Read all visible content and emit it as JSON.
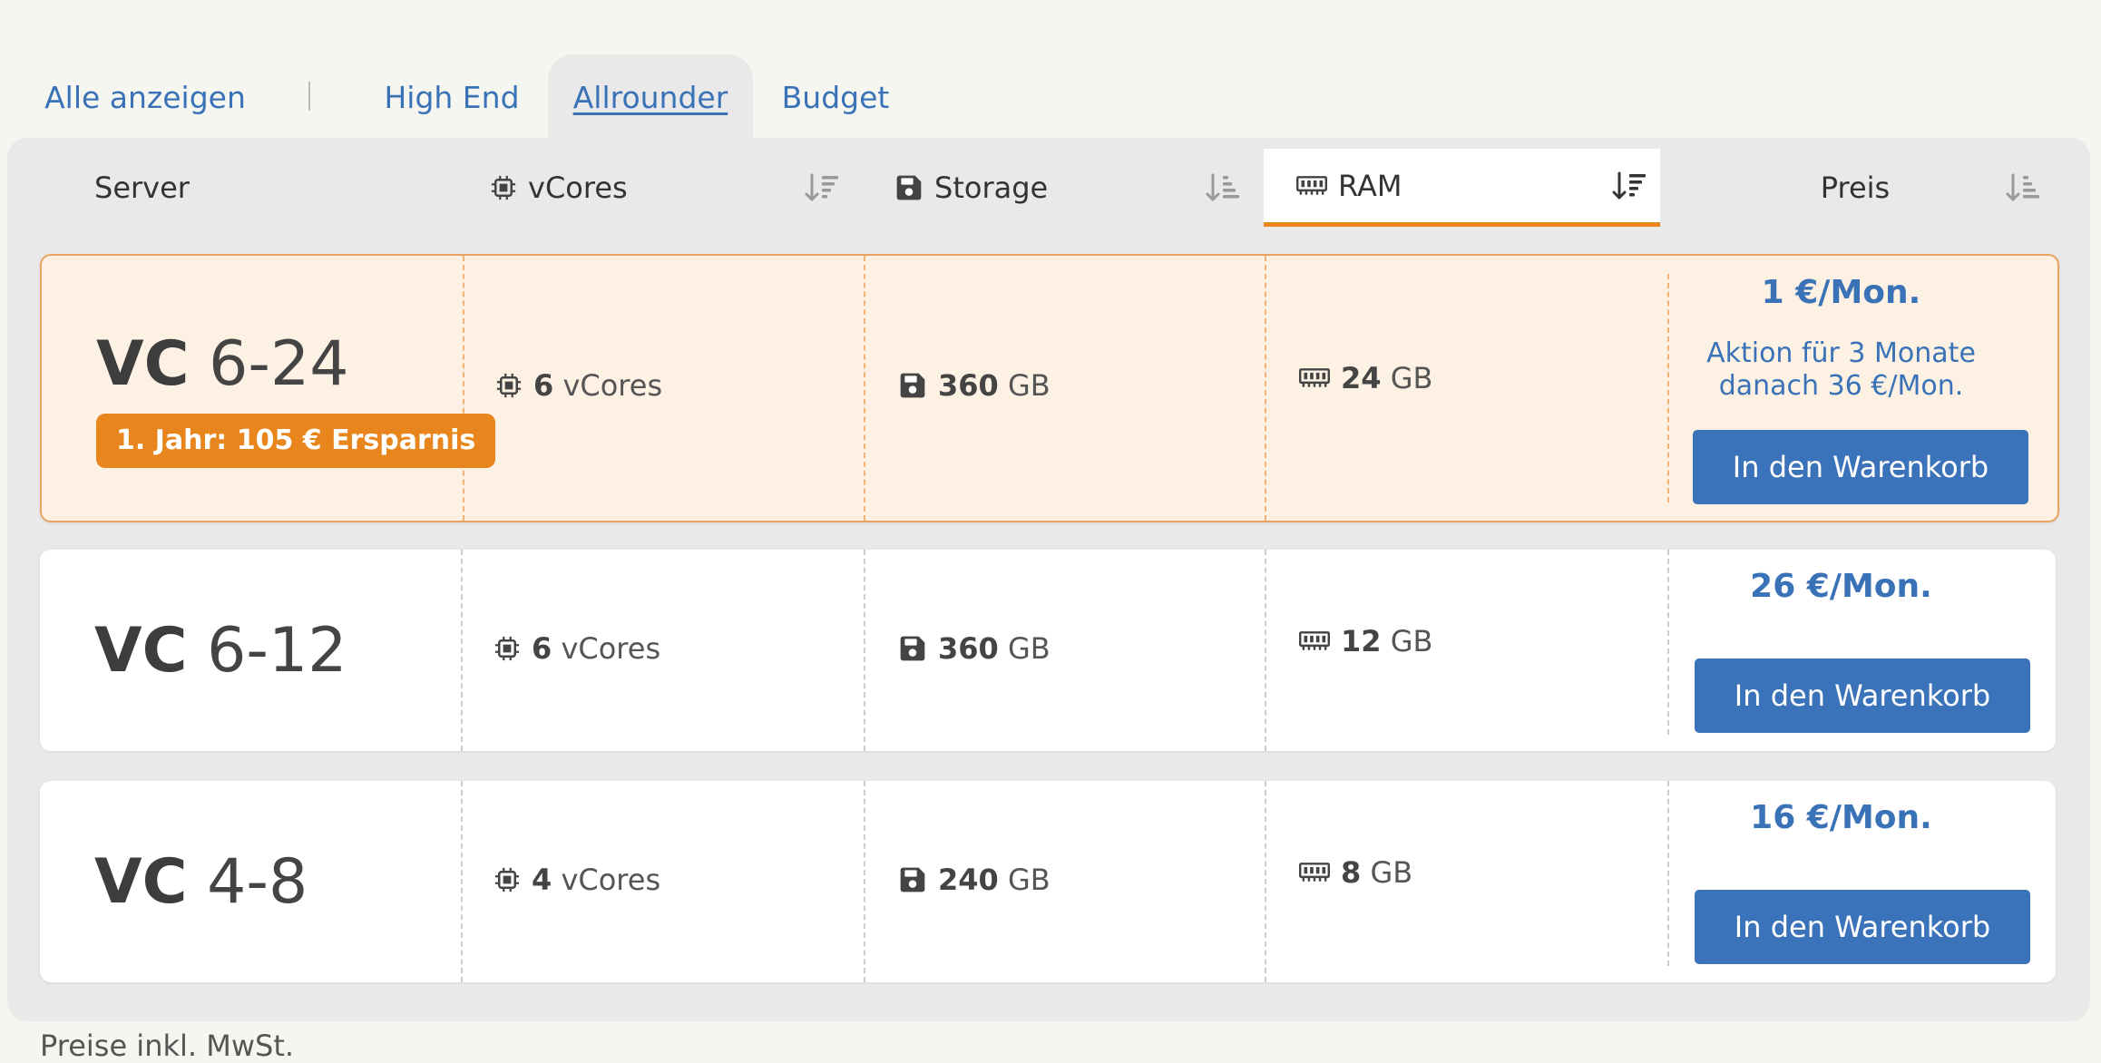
{
  "tabs": [
    {
      "label": "Alle anzeigen"
    },
    {
      "label": "High End"
    },
    {
      "label": "Allrounder",
      "active": true
    },
    {
      "label": "Budget"
    }
  ],
  "table": {
    "headers": {
      "server": "Server",
      "vcores": "vCores",
      "storage": "Storage",
      "ram": "RAM",
      "price": "Preis"
    },
    "sorted_column": "RAM"
  },
  "rows": [
    {
      "name_prefix": "VC",
      "name_suffix": "6-24",
      "badge": "1. Jahr: 105 € Ersparnis",
      "vcores_value": "6",
      "vcores_unit": "vCores",
      "storage_value": "360",
      "storage_unit": "GB",
      "ram_value": "24",
      "ram_unit": "GB",
      "price": "1 €/Mon.",
      "promo_line1": "Aktion für 3 Monate",
      "promo_line2": "danach 36 €/Mon.",
      "button": "In den Warenkorb"
    },
    {
      "name_prefix": "VC",
      "name_suffix": "6-12",
      "vcores_value": "6",
      "vcores_unit": "vCores",
      "storage_value": "360",
      "storage_unit": "GB",
      "ram_value": "12",
      "ram_unit": "GB",
      "price": "26 €/Mon.",
      "button": "In den Warenkorb"
    },
    {
      "name_prefix": "VC",
      "name_suffix": "4-8",
      "vcores_value": "4",
      "vcores_unit": "vCores",
      "storage_value": "240",
      "storage_unit": "GB",
      "ram_value": "8",
      "ram_unit": "GB",
      "price": "16 €/Mon.",
      "button": "In den Warenkorb"
    }
  ],
  "footer": {
    "note": "Preise inkl. MwSt."
  },
  "colors": {
    "accent": "#3a72b8",
    "button": "#3b73ba",
    "highlight_badge": "#e8851c",
    "highlight_row_bg": "#fdf1e4",
    "page_bg": "#f6f6f1",
    "panel_bg": "#e9e9e9"
  },
  "icons": {
    "vcores": "cpu-chip-icon",
    "storage": "floppy-disk-icon",
    "ram": "memory-module-icon",
    "sort": "sort-icon"
  }
}
